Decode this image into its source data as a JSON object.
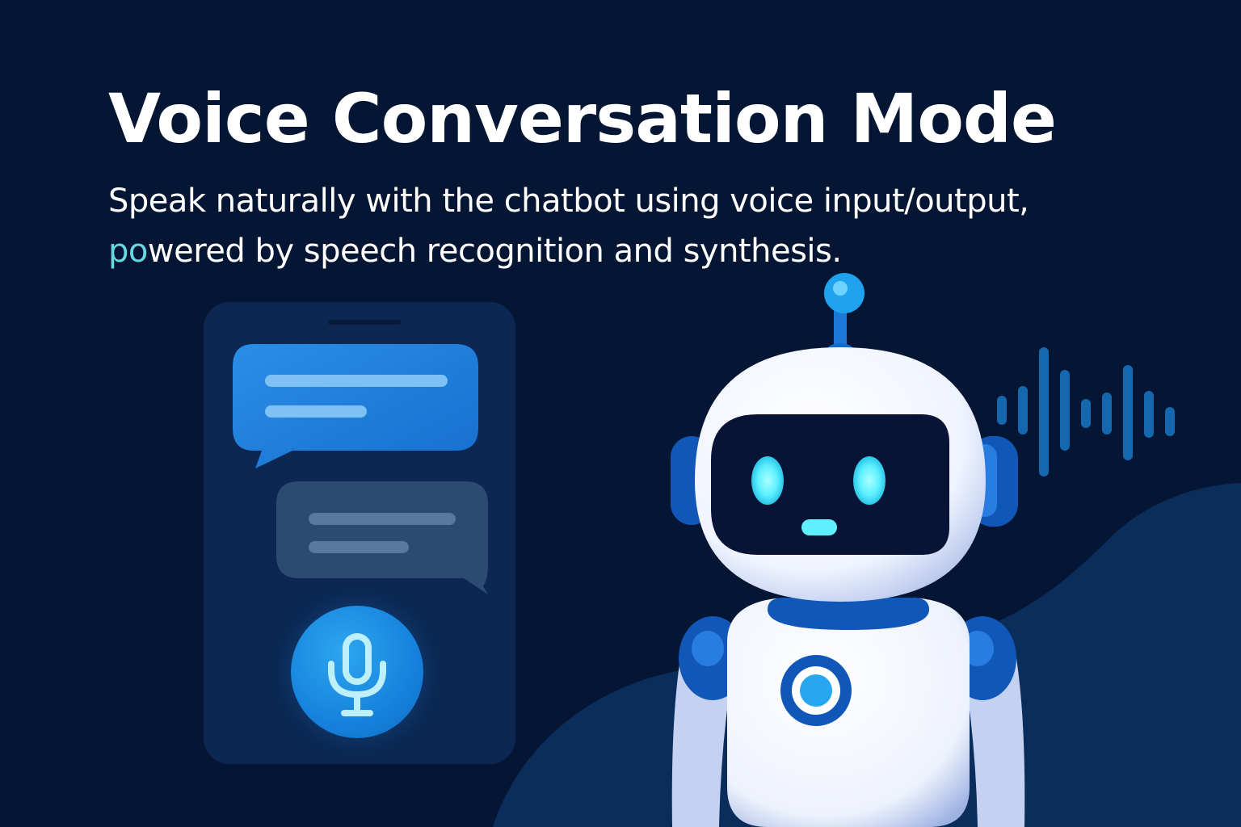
{
  "title": "Voice Conversation Mode",
  "subtitle": {
    "line1": "Speak naturally with the chatbot using voice input/output,",
    "line2_accent": "po",
    "line2_rest": "wered by speech recognition and synthesis."
  },
  "colors": {
    "background": "#051634",
    "accent_text": "#67d8e0",
    "bubble_primary": "#1c7fd9",
    "bubble_secondary": "#2c4a72",
    "robot_body": "#ffffff",
    "robot_trim": "#1157b8",
    "robot_eyes": "#5ef0ff"
  },
  "icons": {
    "microphone": "microphone-icon",
    "robot": "robot-illustration",
    "sound_wave": "sound-wave-icon"
  }
}
